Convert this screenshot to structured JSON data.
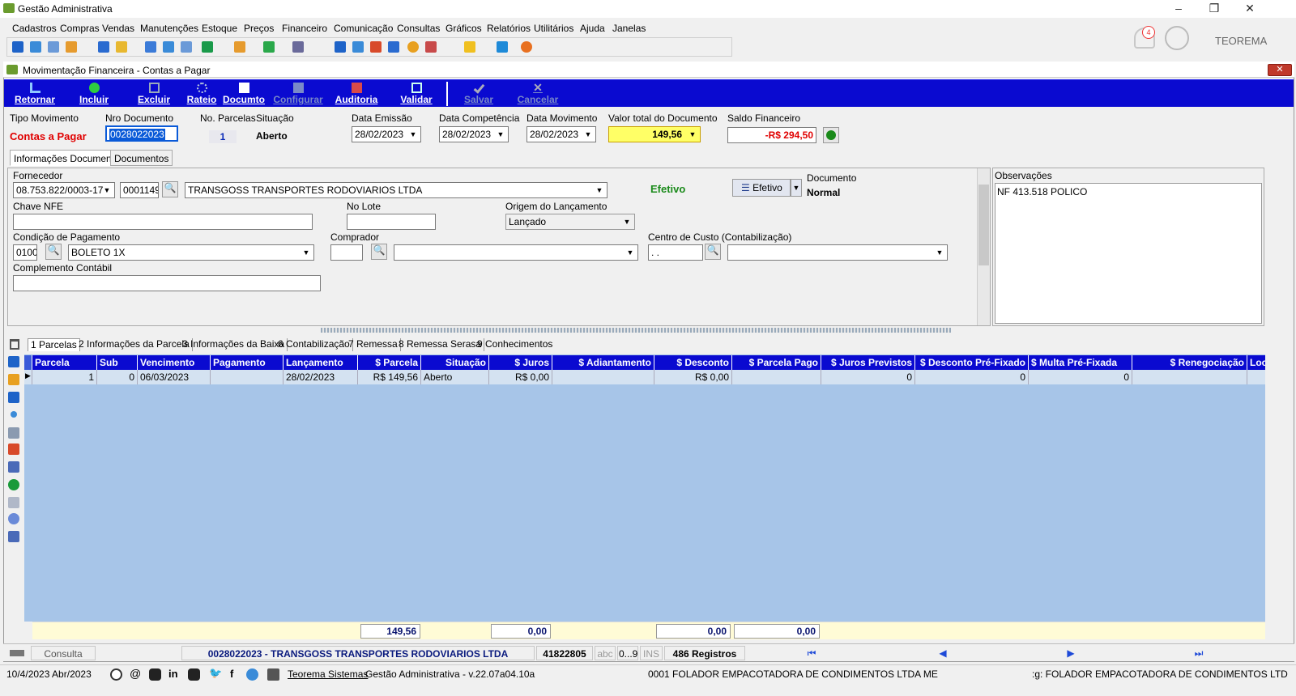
{
  "app": {
    "title": "Gestão Administrativa",
    "brand": "TEOREMA",
    "notifications": "4"
  },
  "menu": [
    "Cadastros",
    "Compras",
    "Vendas",
    "Manutenções",
    "Estoque",
    "Preços",
    "Financeiro",
    "Comunicação",
    "Consultas",
    "Gráficos",
    "Relatórios",
    "Utilitários",
    "Ajuda",
    "Janelas"
  ],
  "window": {
    "title": "Movimentação Financeira - Contas a Pagar"
  },
  "actions": [
    {
      "label": "Retornar",
      "enabled": true
    },
    {
      "label": "Incluir",
      "enabled": true
    },
    {
      "label": "Excluir",
      "enabled": true
    },
    {
      "label": "Rateio",
      "enabled": true
    },
    {
      "label": "Documto",
      "enabled": true
    },
    {
      "label": "Configurar",
      "enabled": false
    },
    {
      "label": "Auditoria",
      "enabled": true
    },
    {
      "label": "Validar",
      "enabled": true
    },
    {
      "label": "Salvar",
      "enabled": false
    },
    {
      "label": "Cancelar",
      "enabled": false
    }
  ],
  "header": {
    "tipo_label": "Tipo Movimento",
    "tipo_value": "Contas a Pagar",
    "nro_label": "Nro Documento",
    "nro_value": "0028022023",
    "parcelas_label": "No. Parcelas",
    "parcelas_value": "1",
    "situacao_label": "Situação",
    "situacao_value": "Aberto",
    "emissao_label": "Data Emissão",
    "emissao_value": "28/02/2023",
    "competencia_label": "Data Competência",
    "competencia_value": "28/02/2023",
    "movimento_label": "Data Movimento",
    "movimento_value": "28/02/2023",
    "valor_label": "Valor total do Documento",
    "valor_value": "149,56",
    "saldo_label": "Saldo Financeiro",
    "saldo_value": "-R$ 294,50"
  },
  "tabs": [
    "Informações Documento",
    "Documentos"
  ],
  "info": {
    "fornecedor_label": "Fornecedor",
    "cnpj": "08.753.822/0003-17",
    "codigo": "0001149",
    "razao": "TRANSGOSS TRANSPORTES RODOVIARIOS LTDA",
    "efetivo_status": "Efetivo",
    "efetivo_button": "Efetivo",
    "documento_label": "Documento",
    "documento_value": "Normal",
    "chave_label": "Chave NFE",
    "chave_value": "",
    "lote_label": "No Lote",
    "lote_value": "",
    "origem_label": "Origem do Lançamento",
    "origem_value": "Lançado",
    "condicao_label": "Condição de Pagamento",
    "condicao_code": "0100",
    "condicao_value": "BOLETO 1X",
    "comprador_label": "Comprador",
    "comprador_code": "",
    "comprador_value": "",
    "centro_label": "Centro de Custo (Contabilização)",
    "centro_code": " .  .",
    "centro_value": "",
    "complemento_label": "Complemento Contábil",
    "complemento_value": ""
  },
  "obs": {
    "label": "Observações",
    "text": "NF 413.518 POLICO"
  },
  "parcel_tabs": [
    "1 Parcelas",
    "2 Informações da Parcela",
    "3 Informações da Baixa",
    "6 Contabilização",
    "7 Remessa",
    "8 Remessa Serasa",
    "9 Conhecimentos"
  ],
  "grid": {
    "columns": [
      "Parcela",
      "Sub",
      "Vencimento",
      "Pagamento",
      "Lançamento",
      "$ Parcela",
      "Situação",
      "$ Juros",
      "$ Adiantamento",
      "$ Desconto",
      "$ Parcela Pago",
      "$ Juros Previstos",
      "$ Desconto Pré-Fixado",
      "$ Multa Pré-Fixada",
      "$ Renegociação",
      "Loc"
    ],
    "rows": [
      [
        "1",
        "0",
        "06/03/2023",
        "",
        "28/02/2023",
        "R$ 149,56",
        "Aberto",
        "R$ 0,00",
        "",
        "R$ 0,00",
        "",
        "0",
        "0",
        "0",
        "",
        ""
      ]
    ],
    "totals": {
      "parcela": "149,56",
      "juros": "0,00",
      "desconto": "0,00",
      "pago": "0,00"
    }
  },
  "status": {
    "mode": "Consulta",
    "doc": "0028022023 - TRANSGOSS TRANSPORTES RODOVIARIOS LTDA",
    "id": "41822805",
    "abc": "abc",
    "num": "0...9",
    "ins": "INS",
    "count": "486 Registros"
  },
  "footer": {
    "date": "10/4/2023 Abr/2023",
    "company_link": "Teorema Sistemas",
    "version": "Gestão Administrativa - v.22.07a04.10a",
    "company": "0001 FOLADOR EMPACOTADORA DE CONDIMENTOS LTDA ME",
    "reg": ":g: FOLADOR EMPACOTADORA DE CONDIMENTOS LTD"
  },
  "colors": {
    "blue": "#0a0ad0",
    "grid": "#a7c5e8",
    "red": "#e00000",
    "green": "#1a8a1a",
    "yellow": "#ffff66"
  }
}
